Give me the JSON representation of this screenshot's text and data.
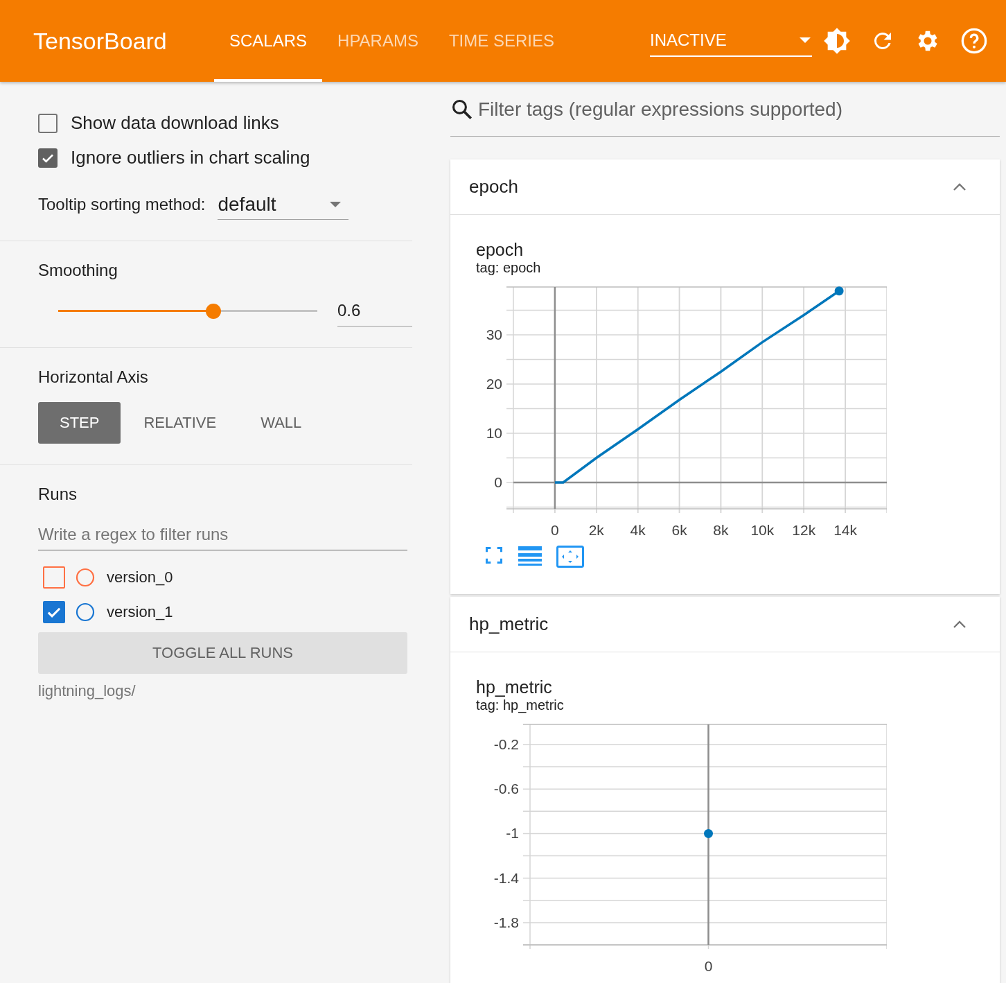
{
  "header": {
    "title": "TensorBoard",
    "tabs": [
      {
        "label": "SCALARS",
        "selected": true
      },
      {
        "label": "HPARAMS",
        "selected": false
      },
      {
        "label": "TIME SERIES",
        "selected": false
      }
    ],
    "run_selector": {
      "value": "INACTIVE"
    }
  },
  "settings": {
    "checkboxes": [
      {
        "label": "Show data download links",
        "checked": false
      },
      {
        "label": "Ignore outliers in chart scaling",
        "checked": true
      }
    ],
    "tooltip_sorting": {
      "label": "Tooltip sorting method:",
      "value": "default"
    }
  },
  "smoothing": {
    "label": "Smoothing",
    "level": 0.6,
    "value": "0.6"
  },
  "horizontal_axis": {
    "label": "Horizontal Axis",
    "options": [
      {
        "label": "STEP",
        "selected": true
      },
      {
        "label": "RELATIVE",
        "selected": false
      },
      {
        "label": "WALL",
        "selected": false
      }
    ]
  },
  "runs": {
    "label": "Runs",
    "filter": {
      "placeholder": "Write a regex to filter runs"
    },
    "items": [
      {
        "name": "version_0",
        "checked": false,
        "color": "#ff7043"
      },
      {
        "name": "version_1",
        "checked": true,
        "color": "#1976d2"
      }
    ],
    "toggle_button": "TOGGLE ALL RUNS",
    "log_dir": "lightning_logs/"
  },
  "tag_filter": {
    "placeholder": "Filter tags (regular expressions supported)"
  },
  "cards": [
    {
      "title": "epoch",
      "expanded": true,
      "chart_title": "epoch",
      "tag": "tag: epoch",
      "chart_data": {
        "type": "line",
        "x": [
          0,
          400,
          2000,
          4000,
          6000,
          8000,
          10000,
          12000,
          13700
        ],
        "series": [
          {
            "color": "#0077bb",
            "values": [
              0,
              0,
              5,
              10.8,
              16.8,
              22.5,
              28.5,
              34,
              38.9
            ]
          }
        ],
        "grid": true,
        "xlim": [
          -2000,
          16000
        ],
        "ylim": [
          -5.35,
          39.7
        ],
        "xticks": [
          {
            "value": 0,
            "label": "0"
          },
          {
            "value": 2000,
            "label": "2k"
          },
          {
            "value": 4000,
            "label": "4k"
          },
          {
            "value": 6000,
            "label": "6k"
          },
          {
            "value": 8000,
            "label": "8k"
          },
          {
            "value": 10000,
            "label": "10k"
          },
          {
            "value": 12000,
            "label": "12k"
          },
          {
            "value": 14000,
            "label": "14k"
          }
        ],
        "yticks": [
          0,
          10,
          20,
          30
        ]
      }
    },
    {
      "title": "hp_metric",
      "expanded": true,
      "chart_title": "hp_metric",
      "tag": "tag: hp_metric",
      "chart_data": {
        "type": "scatter",
        "categories": [
          "0"
        ],
        "series": [
          {
            "color": "#0077bb",
            "values": [
              -1
            ]
          }
        ],
        "grid": true,
        "ref_lines": [
          {
            "axis": "x",
            "value": "0",
            "color": "#8e8e8e"
          }
        ],
        "ylim": [
          -2.0,
          -0.02
        ],
        "yticks": [
          -0.2,
          -0.6,
          -1,
          -1.4,
          -1.8
        ]
      }
    }
  ]
}
